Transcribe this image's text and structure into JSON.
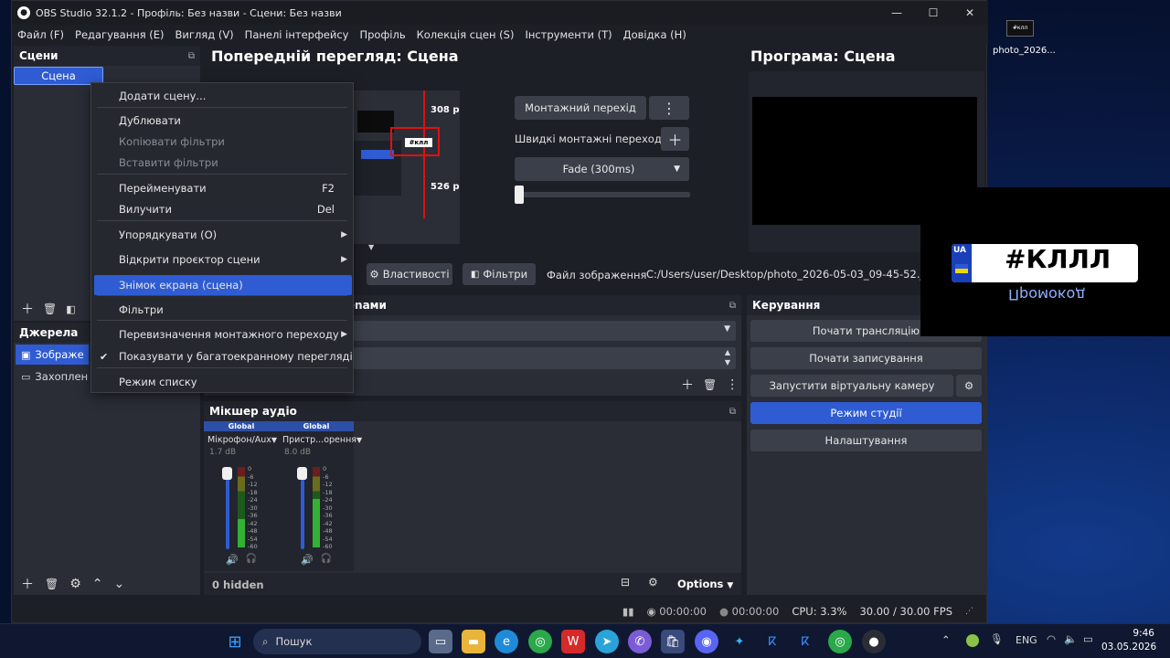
{
  "window": {
    "title": "OBS Studio 32.1.2 - Профіль: Без назви - Сцени: Без назви"
  },
  "menu": [
    "Файл (F)",
    "Редагування (E)",
    "Вигляд (V)",
    "Панелі інтерфейсу",
    "Профіль",
    "Колекція сцен (S)",
    "Інструменти (T)",
    "Довідка (H)"
  ],
  "scenes": {
    "title": "Сцени",
    "items": [
      "Сцена"
    ]
  },
  "sources": {
    "title": "Джерела",
    "items": [
      "Зображе",
      "Захоплен"
    ]
  },
  "context_menu": {
    "items": [
      {
        "label": "Додати сцену...",
        "enabled": true
      },
      {
        "label": "Дублювати",
        "enabled": true
      },
      {
        "label": "Копіювати фільтри",
        "enabled": false
      },
      {
        "label": "Вставити фільтри",
        "enabled": false
      },
      {
        "label": "Перейменувати",
        "shortcut": "F2",
        "enabled": true
      },
      {
        "label": "Вилучити",
        "shortcut": "Del",
        "enabled": true
      },
      {
        "label": "Упорядкувати (O)",
        "submenu": true,
        "enabled": true
      },
      {
        "label": "Відкрити проєктор сцени",
        "submenu": true,
        "enabled": true
      },
      {
        "label": "Знімок екрана (сцена)",
        "enabled": true,
        "highlighted": true
      },
      {
        "label": "Фільтри",
        "enabled": true
      },
      {
        "label": "Перевизначення монтажного переходу",
        "submenu": true,
        "enabled": true
      },
      {
        "label": "Показувати у багатоекранному перегляді",
        "checked": true,
        "enabled": true
      },
      {
        "label": "Режим списку",
        "enabled": true
      }
    ]
  },
  "preview": {
    "title": "Попередній перегляд: Сцена",
    "label_308": "308 р",
    "label_526": "526 р"
  },
  "program": {
    "title": "Програма: Сцена"
  },
  "transition": {
    "button": "Монтажний перехід",
    "quick": "Швидкі монтажні переходи",
    "select": "Fade (300ms)"
  },
  "source_toolbar": {
    "properties": "Властивості",
    "filters": "Фільтри",
    "label": "Файл зображення",
    "path": "C:/Users/user/Desktop/photo_2026-05-03_09-45-52.jpg"
  },
  "transitions_dock": {
    "title": "цenами"
  },
  "mixer": {
    "title": "Мікшер аудіо",
    "channels": [
      {
        "badge": "Global",
        "name": "Мікрофон/Aux",
        "db": "1.7 dB",
        "level": 0.35
      },
      {
        "badge": "Global",
        "name": "Пристр...орення",
        "db": "8.0 dB",
        "level": 0.6
      }
    ],
    "scale": [
      "0",
      "-6",
      "-12",
      "-18",
      "-24",
      "-30",
      "-36",
      "-42",
      "-48",
      "-54",
      "-60"
    ],
    "hidden": "0 hidden",
    "options": "Options"
  },
  "controls": {
    "title": "Керування",
    "buttons": [
      "Почати трансляцію",
      "Почати записування",
      "Запустити віртуальну камеру",
      "Режим студії",
      "Налаштування"
    ]
  },
  "status": {
    "time1": "00:00:00",
    "time2": "00:00:00",
    "cpu": "CPU: 3.3%",
    "fps": "30.00 / 30.00 FPS"
  },
  "desktop": {
    "icon_label": "photo_2026...",
    "overlay_text": "#КЛЛЛ",
    "overlay_badge": "UA",
    "overlay_sub": "Промокод"
  },
  "taskbar": {
    "search": "Пошук",
    "lang": "ENG",
    "time": "9:46",
    "date": "03.05.2026"
  },
  "colors": {
    "accent": "#2f5cd3",
    "panel": "#2a2d36",
    "bg": "#1d1f26"
  }
}
